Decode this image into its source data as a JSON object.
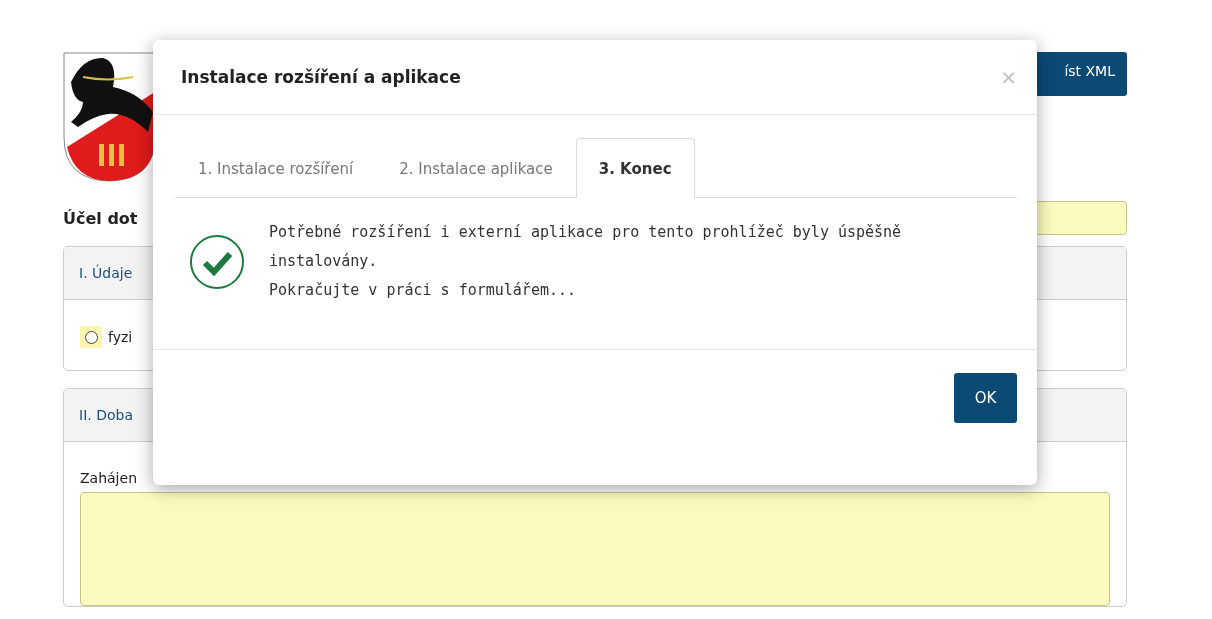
{
  "page": {
    "toolbar_button": "íst XML",
    "heading": "Účel dot",
    "sections": [
      {
        "kind": "radios",
        "title": "I. Údaje",
        "radios": [
          {
            "label": "fyzi",
            "selected": false
          }
        ]
      },
      {
        "kind": "textarea",
        "title": "II. Doba",
        "field_label": "Zahájen"
      }
    ]
  },
  "dialog": {
    "title": "Instalace rozšíření a aplikace",
    "close": "×",
    "tabs": [
      {
        "label": "1. Instalace rozšíření",
        "selected": false
      },
      {
        "label": "2. Instalace aplikace",
        "selected": false
      },
      {
        "label": "3. Konec",
        "selected": true
      }
    ],
    "message": {
      "kind": "success",
      "lines": [
        "Potřebné rozšíření i externí aplikace pro tento prohlížeč byly úspěšně instalovány.",
        "Pokračujte v práci s formulářem..."
      ]
    },
    "buttons": [
      "OK"
    ]
  }
}
